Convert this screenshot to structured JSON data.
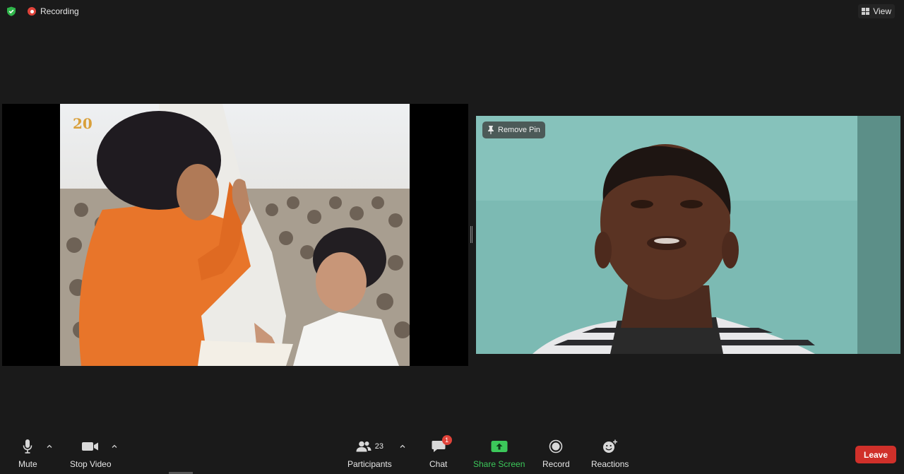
{
  "top": {
    "recording_label": "Recording",
    "view_label": "View"
  },
  "share": {
    "logo_text": "20"
  },
  "participant": {
    "remove_pin_label": "Remove Pin"
  },
  "toolbar": {
    "mute_label": "Mute",
    "stop_video_label": "Stop Video",
    "participants_label": "Participants",
    "participants_count": "23",
    "chat_label": "Chat",
    "chat_badge": "1",
    "share_screen_label": "Share Screen",
    "record_label": "Record",
    "reactions_label": "Reactions",
    "leave_label": "Leave"
  },
  "colors": {
    "background": "#1a1a1a",
    "recording_red": "#e0433a",
    "share_green": "#3cc85a",
    "leave_red": "#d0302a",
    "security_green": "#2fb54a"
  },
  "icons": [
    "shield-icon",
    "recording-icon",
    "grid-view-icon",
    "pin-icon",
    "microphone-icon",
    "video-camera-icon",
    "participants-icon",
    "chat-icon",
    "share-screen-icon",
    "record-icon",
    "reactions-icon",
    "caret-up-icon"
  ]
}
